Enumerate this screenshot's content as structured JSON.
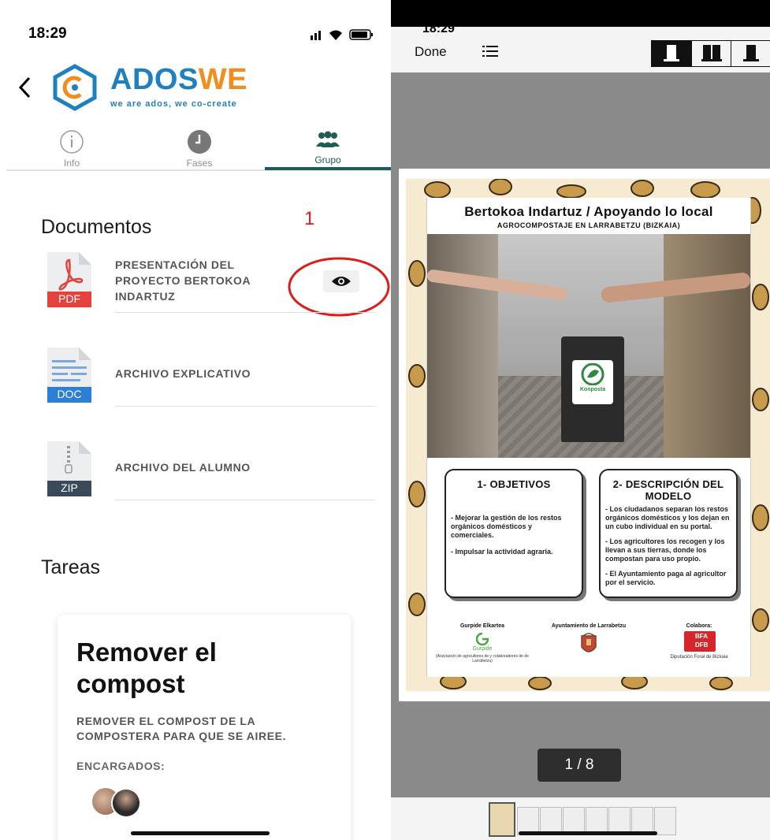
{
  "left": {
    "status_time": "18:29",
    "brand": {
      "name_part1": "ADOS",
      "name_part2": "WE",
      "tagline": "we are ados, we co-create"
    },
    "tabs": [
      {
        "label": "Info",
        "icon": "info-icon"
      },
      {
        "label": "Fases",
        "icon": "clock-icon"
      },
      {
        "label": "Grupo",
        "icon": "group-icon",
        "active": true
      }
    ],
    "annotation_number": "1",
    "documents": {
      "heading": "Documentos",
      "items": [
        {
          "type": "PDF",
          "title": "PRESENTACIÓN DEL PROYECTO BERTOKOA INDARTUZ",
          "has_view_button": true
        },
        {
          "type": "DOC",
          "title": "ARCHIVO EXPLICATIVO"
        },
        {
          "type": "ZIP",
          "title": "ARCHIVO DEL ALUMNO"
        }
      ]
    },
    "tasks": {
      "heading": "Tareas",
      "card": {
        "title": "Remover el compost",
        "description": "REMOVER EL COMPOST DE LA COMPOSTERA PARA QUE SE AIREE.",
        "assignees_label": "ENCARGADOS:"
      }
    }
  },
  "right": {
    "status_time": "18:29",
    "done_label": "Done",
    "page_indicator": "1 / 8",
    "poster": {
      "title": "Bertokoa Indartuz / Apoyando lo local",
      "subtitle": "AGROCOMPOSTAJE EN LARRABETZU (BIZKAIA)",
      "bin_label": "Konposta",
      "box1": {
        "heading": "1- OBJETIVOS",
        "lines": [
          "- Mejorar la gestión de los restos orgánicos domésticos y comerciales.",
          "- Impulsar la actividad agraria."
        ]
      },
      "box2": {
        "heading": "2- DESCRIPCIÓN DEL MODELO",
        "lines": [
          "- Los ciudadanos separan los restos orgánicos domésticos y los dejan en un cubo individual en su portal.",
          "- Los agricultores los recogen y los llevan a sus tierras, donde los compostan para uso propio.",
          "- El Ayuntamiento paga al agricultor por el servicio."
        ]
      },
      "footer": {
        "org1": "Gurpide Elkartea",
        "org1_logo_text": "Gurpide",
        "org1_caption": "(Asociación de agricultores de y colaboradores de de Larrabetzu)",
        "org2": "Ayuntamiento de Larrabetzu",
        "org3_label": "Colabora:",
        "org3_logo_line1": "BFA",
        "org3_logo_line2": "DFB",
        "org3_caption": "Diputación Foral de Bizkaia"
      }
    }
  },
  "colors": {
    "brand_blue": "#1e7fc1",
    "brand_orange": "#f28c1c",
    "tab_active": "#1f5c56",
    "annotation_red": "#e01b1b",
    "pdf_red": "#e2433d",
    "doc_blue": "#2b7fd4",
    "zip_gray": "#3a4a5a"
  }
}
